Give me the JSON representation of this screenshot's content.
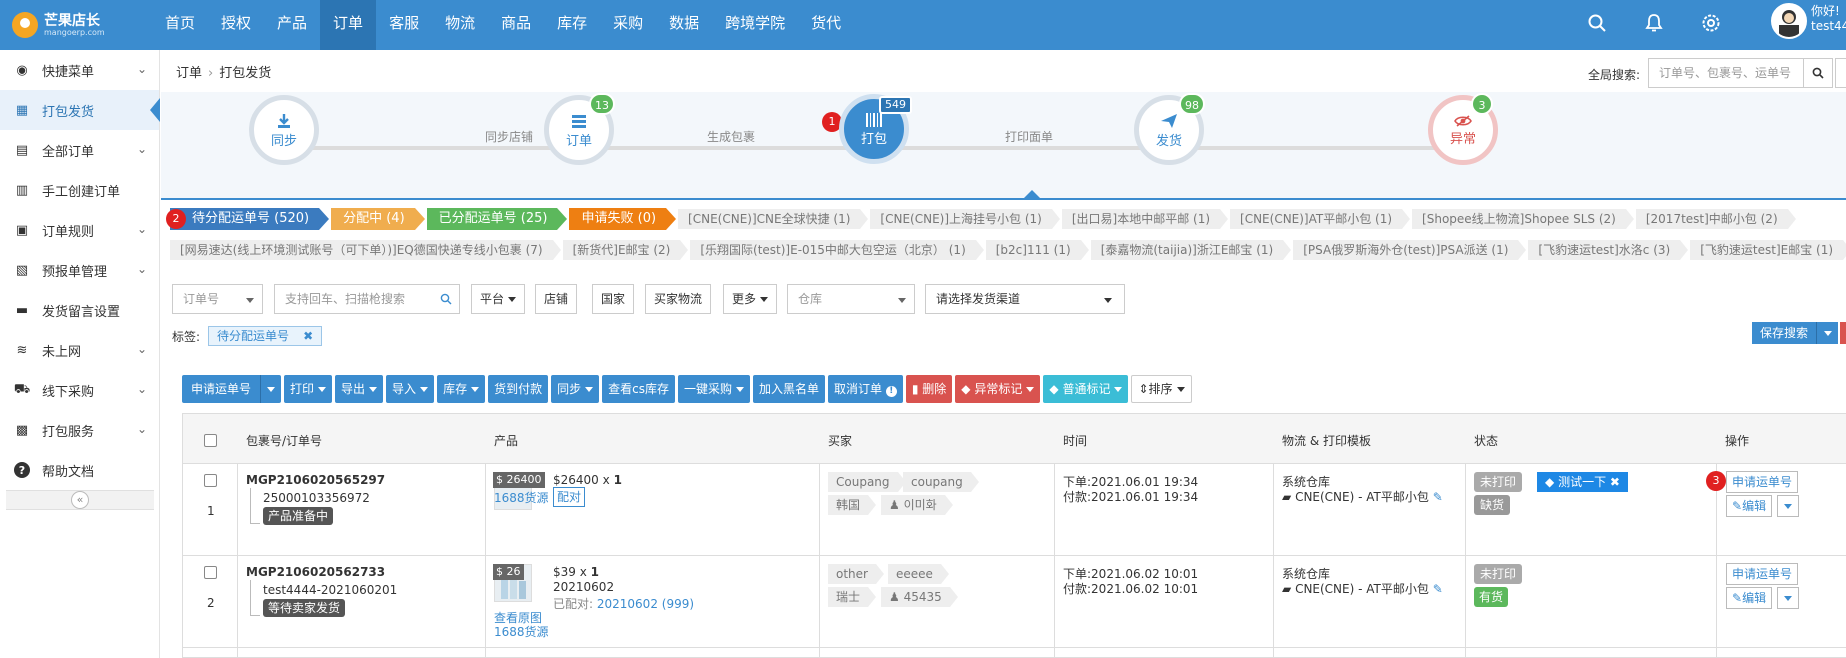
{
  "brand": {
    "name": "芒果店长",
    "domain": "mangoerp.com"
  },
  "nav": [
    "首页",
    "授权",
    "产品",
    "订单",
    "客服",
    "物流",
    "商品",
    "库存",
    "采购",
    "数据",
    "跨境学院",
    "货代"
  ],
  "user": {
    "greeting": "你好!",
    "name": "test44"
  },
  "sidebar": [
    {
      "label": "快捷菜单",
      "icon": "speedometer-icon",
      "chevron": true
    },
    {
      "label": "打包发货",
      "icon": "package-icon",
      "chevron": false,
      "active": true
    },
    {
      "label": "全部订单",
      "icon": "clipboard-icon",
      "chevron": true
    },
    {
      "label": "手工创建订单",
      "icon": "edit-doc-icon",
      "chevron": false
    },
    {
      "label": "订单规则",
      "icon": "rules-icon",
      "chevron": true
    },
    {
      "label": "预报单管理",
      "icon": "forecast-icon",
      "chevron": true
    },
    {
      "label": "发货留言设置",
      "icon": "message-icon",
      "chevron": false
    },
    {
      "label": "未上网",
      "icon": "wifi-icon",
      "chevron": true
    },
    {
      "label": "线下采购",
      "icon": "cart-icon",
      "chevron": true
    },
    {
      "label": "打包服务",
      "icon": "box-service-icon",
      "chevron": true
    },
    {
      "label": "帮助文档",
      "icon": "help-icon",
      "chevron": false
    }
  ],
  "breadcrumb": [
    "订单",
    "打包发货"
  ],
  "global_search": {
    "label": "全局搜索:",
    "placeholder": "订单号、包裹号、运单号"
  },
  "workflow": {
    "steps": [
      {
        "label": "同步",
        "badge": ""
      },
      {
        "label": "订单",
        "badge": "13"
      },
      {
        "label": "打包",
        "badge": "549"
      },
      {
        "label": "发货",
        "badge": "98"
      },
      {
        "label": "异常",
        "badge": "3"
      }
    ],
    "connectors": [
      "同步店铺",
      "生成包裹",
      "打印面单"
    ],
    "step_marker": "1"
  },
  "status_tabs": [
    {
      "label": "待分配运单号 (520)"
    },
    {
      "label": "分配中 (4)"
    },
    {
      "label": "已分配运单号 (25)"
    },
    {
      "label": "申请失败 (0)"
    }
  ],
  "status_marker": "2",
  "channel_tags_row1": [
    "[CNE(CNE)]CNE全球快捷 (1)",
    "[CNE(CNE)]上海挂号小包 (1)",
    "[出口易]本地中邮平邮 (1)",
    "[CNE(CNE)]AT平邮小包 (1)",
    "[Shopee线上物流]Shopee SLS (2)",
    "[2017test]中邮小包 (2)"
  ],
  "channel_tags_row2": [
    "[网易速达(线上环境测试账号（可下单）)]EQ德国快递专线小包裹 (7)",
    "[新货代]E邮宝 (2)",
    "[乐翔国际(test)]E-015中邮大包空运（北京） (1)",
    "[b2c]111 (1)",
    "[泰嘉物流(taijia)]浙江E邮宝 (1)",
    "[PSA俄罗斯海外仓(test)]PSA派送 (1)",
    "[飞豹速运test]水洛c (3)",
    "[飞豹速运test]E邮宝 (1)"
  ],
  "filters": {
    "order_field": "订单号",
    "search_placeholder": "支持回车、扫描枪搜索",
    "platform": "平台",
    "shop": "店铺",
    "country": "国家",
    "buyer_logistics": "买家物流",
    "more": "更多",
    "warehouse": "仓库",
    "channel": "请选择发货渠道"
  },
  "label_row": {
    "label": "标签:",
    "tag": "待分配运单号"
  },
  "save_search": "保存搜索",
  "toolbar": [
    "申请运单号",
    "打印",
    "导出",
    "导入",
    "库存",
    "货到付款",
    "同步",
    "查看cs库存",
    "一键采购",
    "加入黑名单",
    "取消订单",
    "删除",
    "异常标记",
    "普通标记",
    "排序"
  ],
  "columns": [
    "包裹号/订单号",
    "产品",
    "买家",
    "时间",
    "物流 & 打印模板",
    "状态",
    "操作"
  ],
  "rows": [
    {
      "index": "1",
      "package_no": "MGP2106020565297",
      "order_no": "25000103356972",
      "order_status": "产品准备中",
      "price_tag": "$ 26400",
      "price": "$26400",
      "qty": "x",
      "qty_num": "1",
      "product_link": "1688货源",
      "product_btn": "配对",
      "buyer_chips": [
        "Coupang",
        "coupang"
      ],
      "country": "韩国",
      "buyer_name": "이미화",
      "order_time": "下单:2021.06.01 19:34",
      "pay_time": "付款:2021.06.01 19:34",
      "warehouse": "系统仓库",
      "channel": "CNE(CNE) - AT平邮小包",
      "print_status": "未打印",
      "custom_tag": "测试一下",
      "stock_status": "缺货",
      "action_marker": "3",
      "apply_btn": "申请运单号",
      "edit_btn": "编辑"
    },
    {
      "index": "2",
      "package_no": "MGP2106020562733",
      "order_no": "test4444-2021060201",
      "order_status": "等待卖家发货",
      "price_tag": "$ 26",
      "price": "$39",
      "qty": "x",
      "qty_num": "1",
      "sku": "20210602",
      "paired_label": "已配对:",
      "paired_value": "20210602 (999)",
      "link_view": "查看原图",
      "product_link": "1688货源",
      "buyer_chips": [
        "other",
        "eeeee"
      ],
      "country": "瑞士",
      "buyer_name": "45435",
      "order_time": "下单:2021.06.02 10:01",
      "pay_time": "付款:2021.06.02 10:01",
      "warehouse": "系统仓库",
      "channel": "CNE(CNE) - AT平邮小包",
      "print_status": "未打印",
      "stock_status": "有货",
      "apply_btn": "申请运单号",
      "edit_btn": "编辑"
    }
  ],
  "colors": {
    "primary": "#3b8ccf",
    "success": "#5cb85c",
    "warning": "#f0ad4e",
    "danger": "#d9534f",
    "orange": "#ee7f12"
  }
}
